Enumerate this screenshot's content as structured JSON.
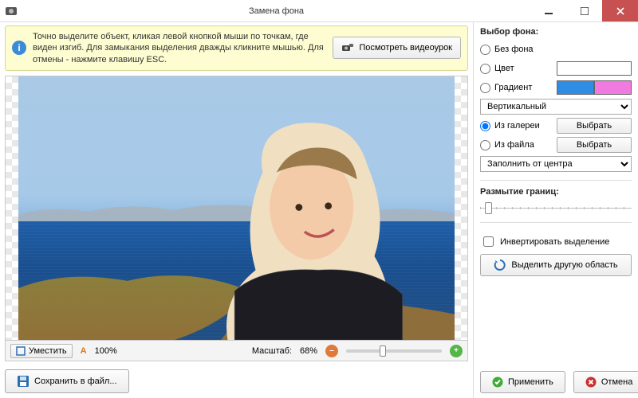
{
  "window": {
    "title": "Замена фона"
  },
  "tip": {
    "text": "Точно выделите объект, кликая левой кнопкой мыши по точкам, где виден изгиб. Для замыкания выделения дважды кликните мышью. Для отмены - нажмите клавишу ESC.",
    "video_btn": "Посмотреть видеоурок"
  },
  "status": {
    "fit_btn": "Уместить",
    "zoom_a_label": "100%",
    "zoom_label": "Масштаб:",
    "zoom_value": "68%",
    "zoom_slider_pos_pct": 35
  },
  "bottom": {
    "save_btn": "Сохранить в файл...",
    "apply_btn": "Применить",
    "cancel_btn": "Отмена"
  },
  "panel": {
    "heading": "Выбор фона:",
    "no_bg": "Без фона",
    "color": "Цвет",
    "gradient": "Градиент",
    "gradient_color1": "#2f8de6",
    "gradient_color2": "#f07ae0",
    "gradient_dir_options": [
      "Вертикальный"
    ],
    "gradient_dir_selected": "Вертикальный",
    "from_gallery": "Из галереи",
    "from_file": "Из файла",
    "choose_btn": "Выбрать",
    "fill_mode_options": [
      "Заполнить от центра"
    ],
    "fill_mode_selected": "Заполнить от центра",
    "blur_heading": "Размытие границ:",
    "blur_pos_pct": 4,
    "invert_label": "Инвертировать выделение",
    "reselect_btn": "Выделить другую область",
    "selected_radio": "from_gallery"
  },
  "colors": {
    "accent_close": "#c75050",
    "apply_green": "#3faa36",
    "cancel_red": "#c9302c"
  }
}
